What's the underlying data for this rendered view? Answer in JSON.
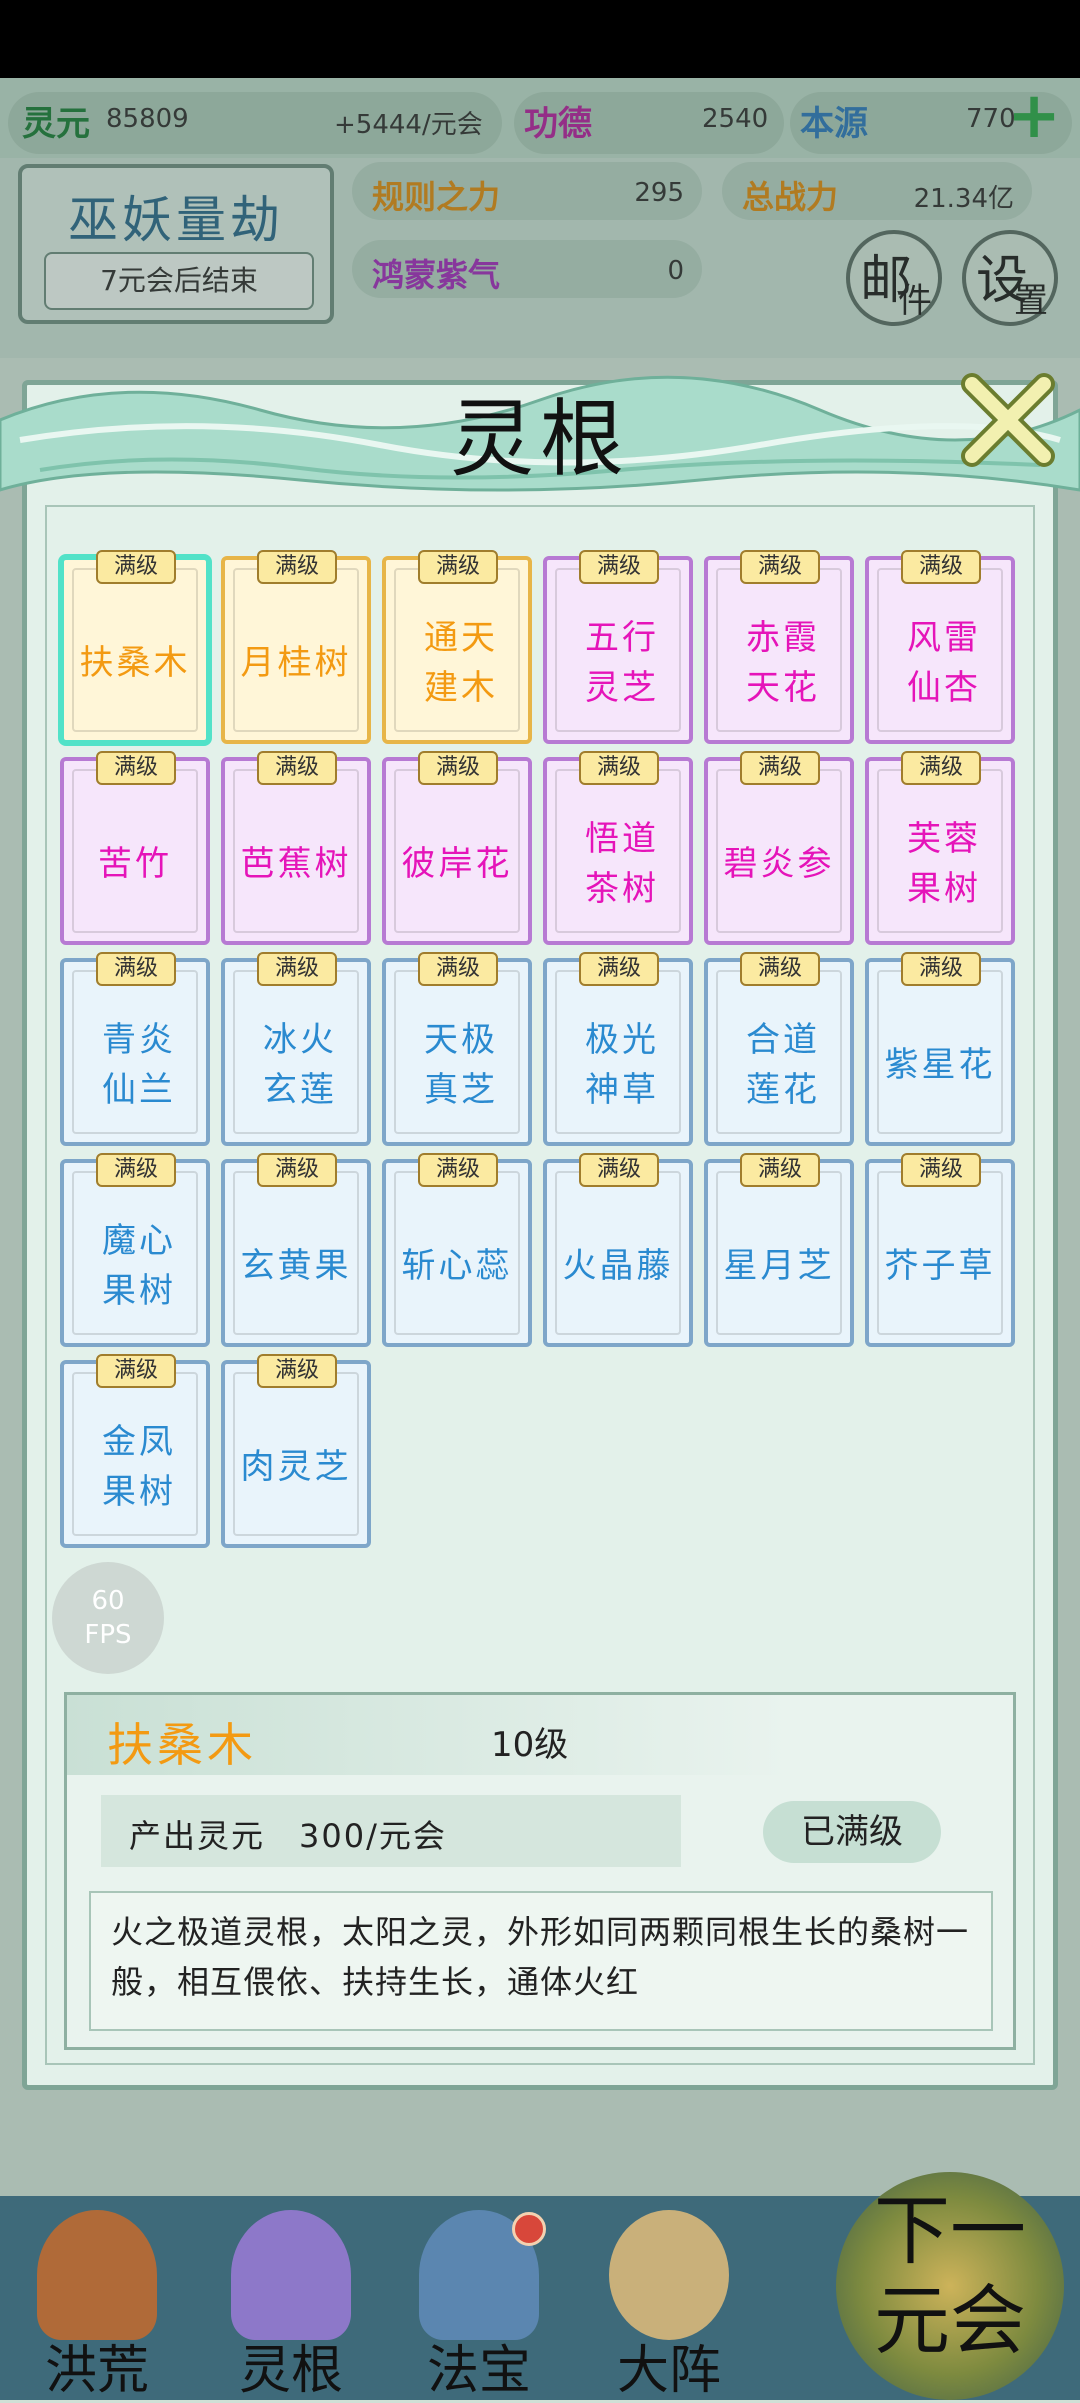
{
  "hud": {
    "lingyuan_label": "灵元",
    "lingyuan_value": "85809",
    "lingyuan_rate": "+5444/元会",
    "gongde_label": "功德",
    "gongde_value": "2540",
    "benyuan_label": "本源",
    "benyuan_value": "770",
    "guize_label": "规则之力",
    "guize_value": "295",
    "zhanli_label": "总战力",
    "zhanli_value": "21.34亿",
    "hongmeng_label": "鸿蒙紫气",
    "hongmeng_value": "0"
  },
  "event": {
    "title": "巫妖量劫",
    "subtitle": "7元会后结束"
  },
  "buttons": {
    "mail_big": "邮",
    "mail_small": "件",
    "settings_big": "设",
    "settings_small": "置"
  },
  "modal": {
    "title": "灵根"
  },
  "badge_text": "满级",
  "cards": [
    {
      "name": "扶桑木",
      "tier": "gold",
      "selected": true
    },
    {
      "name": "月桂树",
      "tier": "gold"
    },
    {
      "name": "通天建木",
      "tier": "gold"
    },
    {
      "name": "五行灵芝",
      "tier": "purple"
    },
    {
      "name": "赤霞天花",
      "tier": "purple"
    },
    {
      "name": "风雷仙杏",
      "tier": "purple"
    },
    {
      "name": "苦竹",
      "tier": "purple"
    },
    {
      "name": "芭蕉树",
      "tier": "purple"
    },
    {
      "name": "彼岸花",
      "tier": "purple"
    },
    {
      "name": "悟道茶树",
      "tier": "purple"
    },
    {
      "name": "碧炎参",
      "tier": "purple"
    },
    {
      "name": "芙蓉果树",
      "tier": "purple"
    },
    {
      "name": "青炎仙兰",
      "tier": "blue"
    },
    {
      "name": "冰火玄莲",
      "tier": "blue"
    },
    {
      "name": "天极真芝",
      "tier": "blue"
    },
    {
      "name": "极光神草",
      "tier": "blue"
    },
    {
      "name": "合道莲花",
      "tier": "blue"
    },
    {
      "name": "紫星花",
      "tier": "blue"
    },
    {
      "name": "魔心果树",
      "tier": "blue"
    },
    {
      "name": "玄黄果",
      "tier": "blue"
    },
    {
      "name": "斩心蕊",
      "tier": "blue"
    },
    {
      "name": "火晶藤",
      "tier": "blue"
    },
    {
      "name": "星月芝",
      "tier": "blue"
    },
    {
      "name": "芥子草",
      "tier": "blue"
    },
    {
      "name": "金凤果树",
      "tier": "blue"
    },
    {
      "name": "肉灵芝",
      "tier": "blue"
    }
  ],
  "fps": {
    "value": "60",
    "unit": "FPS"
  },
  "detail": {
    "name": "扶桑木",
    "level": "10级",
    "output": "产出灵元　300/元会",
    "status": "已满级",
    "description": "火之极道灵根，太阳之灵，外形如同两颗同根生长的桑树一般，相互偎依、扶持生长，通体火红"
  },
  "nav": {
    "items": [
      "洪荒",
      "灵根",
      "法宝",
      "大阵"
    ],
    "next_line1": "下一",
    "next_line2": "元会"
  },
  "colors": {
    "gold_text": "#f39a12",
    "purple_text": "#e514b9",
    "blue_text": "#2a8ad0"
  }
}
